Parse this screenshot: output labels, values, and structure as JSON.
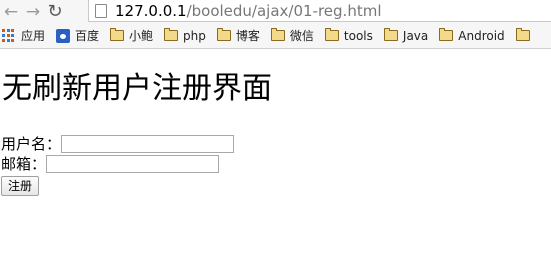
{
  "browser": {
    "url_host": "127.0.0.1",
    "url_path": "/booledu/ajax/01-reg.html"
  },
  "bookmarks": [
    {
      "label": "应用",
      "icon": "apps-icon"
    },
    {
      "label": "百度",
      "icon": "paw-icon"
    },
    {
      "label": "小鲍",
      "icon": "folder-icon"
    },
    {
      "label": "php",
      "icon": "folder-icon"
    },
    {
      "label": "博客",
      "icon": "folder-icon"
    },
    {
      "label": "微信",
      "icon": "folder-icon"
    },
    {
      "label": "tools",
      "icon": "folder-icon"
    },
    {
      "label": "Java",
      "icon": "folder-icon"
    },
    {
      "label": "Android",
      "icon": "folder-icon"
    }
  ],
  "page": {
    "title": "无刷新用户注册界面",
    "username_label": "用户名：",
    "email_label": "邮箱：",
    "username_value": "",
    "email_value": "",
    "submit_label": "注册"
  }
}
